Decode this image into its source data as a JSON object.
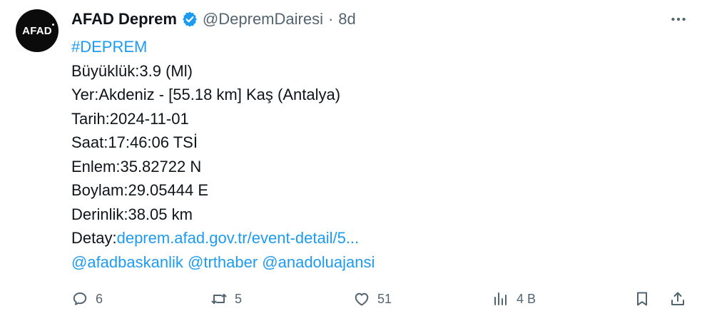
{
  "author": {
    "avatar_text": "AFAD",
    "name": "AFAD Deprem",
    "handle": "@DepremDairesi",
    "separator": "·",
    "time": "8d"
  },
  "body": {
    "hashtag": "#DEPREM",
    "magnitude": "Büyüklük:3.9 (Ml)",
    "location": "Yer:Akdeniz - [55.18 km] Kaş (Antalya)",
    "date": "Tarih:2024-11-01",
    "time": "Saat:17:46:06 TSİ",
    "latitude": "Enlem:35.82722 N",
    "longitude": "Boylam:29.05444 E",
    "depth": "Derinlik:38.05 km",
    "detail_label": "Detay:",
    "detail_link": "deprem.afad.gov.tr/event-detail/5...",
    "mentions": [
      "@afadbaskanlik",
      "@trthaber",
      "@anadoluajansi"
    ]
  },
  "actions": {
    "replies": "6",
    "retweets": "5",
    "likes": "51",
    "views": "4 B"
  },
  "colors": {
    "text": "#0f1419",
    "secondary": "#536471",
    "link": "#1d9bf0",
    "verified": "#1d9bf0"
  },
  "icons": {
    "more": "more-horizontal-icon",
    "reply": "reply-icon",
    "retweet": "retweet-icon",
    "like": "heart-icon",
    "views": "analytics-icon",
    "bookmark": "bookmark-icon",
    "share": "share-icon",
    "verified": "verified-badge-icon"
  }
}
